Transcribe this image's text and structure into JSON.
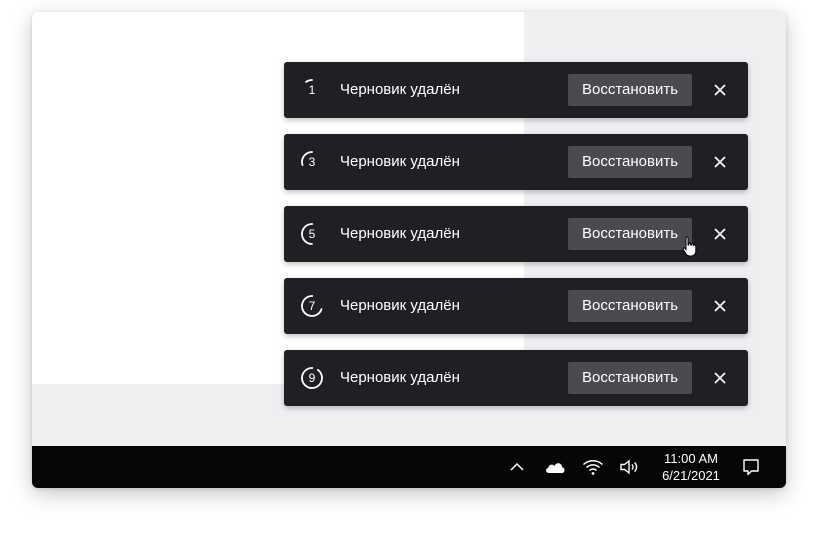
{
  "toasts": [
    {
      "timer": "1",
      "progress": 0.1,
      "message": "Черновик удалён",
      "restore_label": "Восстановить",
      "close_icon": "close-icon"
    },
    {
      "timer": "3",
      "progress": 0.3,
      "message": "Черновик удалён",
      "restore_label": "Восстановить",
      "close_icon": "close-icon"
    },
    {
      "timer": "5",
      "progress": 0.5,
      "message": "Черновик удалён",
      "restore_label": "Восстановить",
      "close_icon": "close-icon"
    },
    {
      "timer": "7",
      "progress": 0.7,
      "message": "Черновик удалён",
      "restore_label": "Восстановить",
      "close_icon": "close-icon"
    },
    {
      "timer": "9",
      "progress": 0.9,
      "message": "Черновик удалён",
      "restore_label": "Восстановить",
      "close_icon": "close-icon"
    }
  ],
  "taskbar": {
    "icons": [
      "chevron-up-icon",
      "cloud-icon",
      "wifi-icon",
      "speaker-icon",
      "notification-icon"
    ],
    "time": "11:00 AM",
    "date": "6/21/2021"
  },
  "colors": {
    "toast_bg": "#1f2023",
    "button_bg": "#4a4b4e",
    "pane_bg": "#eeeff1",
    "taskbar_bg": "#060606"
  }
}
